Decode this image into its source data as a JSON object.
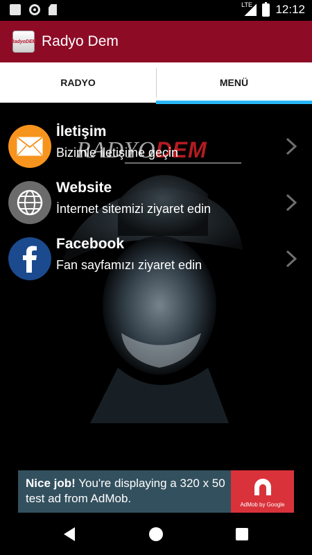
{
  "status_bar": {
    "network": "LTE",
    "time": "12:12"
  },
  "app_bar": {
    "title": "Radyo Dem",
    "logo_text": "RadyoDEM"
  },
  "tabs": [
    {
      "label": "RADYO"
    },
    {
      "label": "MENÜ"
    }
  ],
  "watermark": {
    "text1": "RADYO",
    "text2": "DEM"
  },
  "menu_items": [
    {
      "title": "İletişim",
      "subtitle": "Bizimle iletişime geçin",
      "icon": "mail-icon",
      "color": "#f7941e"
    },
    {
      "title": "Website",
      "subtitle": "İnternet sitemizi ziyaret edin",
      "icon": "globe-icon",
      "color": "#6b6b6b"
    },
    {
      "title": "Facebook",
      "subtitle": "Fan sayfamızı ziyaret edin",
      "icon": "facebook-icon",
      "color": "#1c4a8f"
    }
  ],
  "ad": {
    "headline": "Nice job!",
    "body": " You're displaying a 320 x 50 test ad from AdMob.",
    "logo_text": "AdMob by Google"
  },
  "colors": {
    "app_bar": "#8e0b26",
    "tab_indicator": "#29b6f6",
    "ad_bg": "#33505e",
    "ad_logo": "#d9323a"
  }
}
